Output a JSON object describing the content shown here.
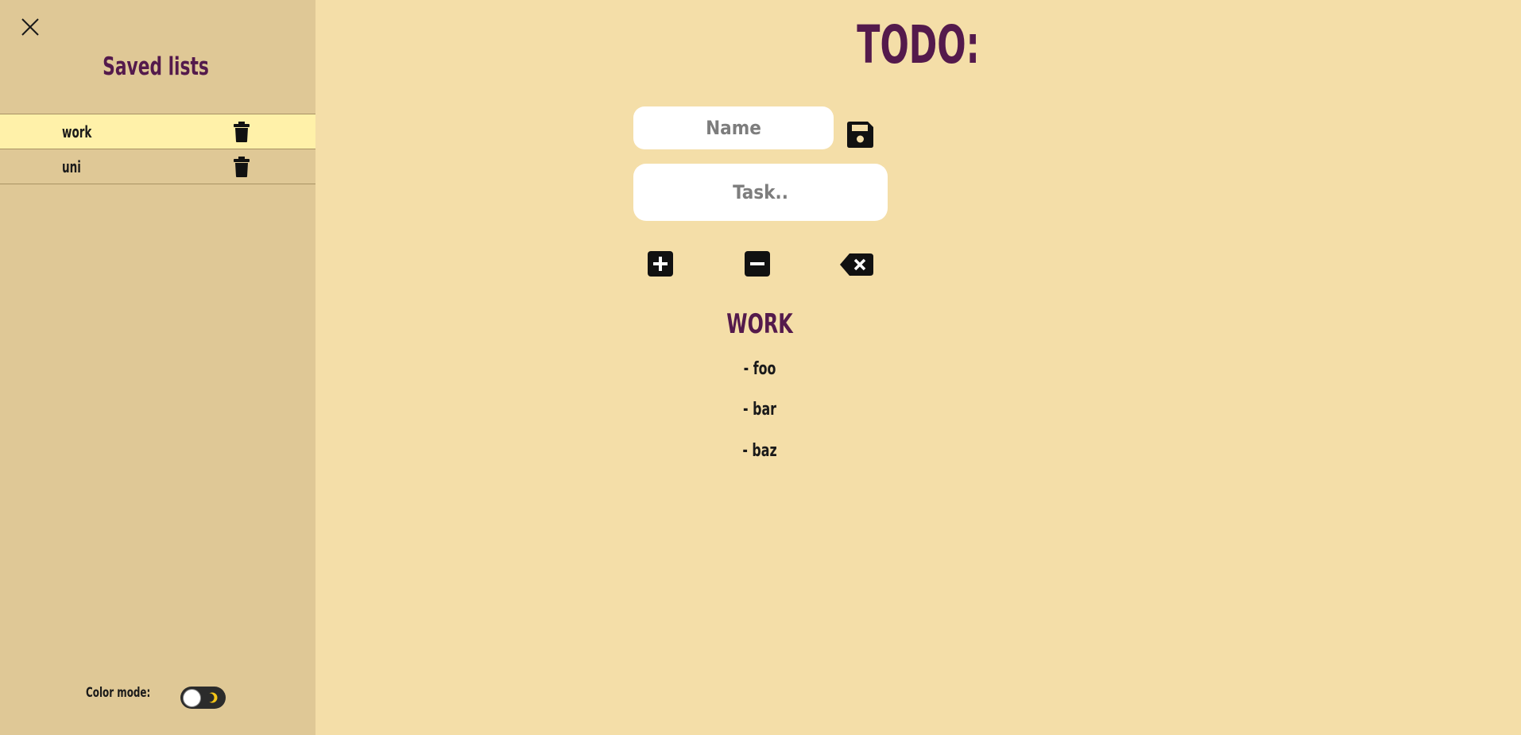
{
  "sidebar": {
    "title": "Saved lists",
    "items": [
      {
        "label": "work",
        "active": true
      },
      {
        "label": "uni",
        "active": false
      }
    ],
    "color_mode_label": "Color mode:"
  },
  "main": {
    "title": "TODO:",
    "name_placeholder": "Name",
    "task_placeholder": "Task..",
    "list_heading": "WORK",
    "tasks": [
      "- foo",
      "- bar",
      "- baz"
    ]
  },
  "icons": {
    "close": "close-icon",
    "trash": "trash-icon",
    "save": "save-icon",
    "add": "plus-square-icon",
    "remove": "minus-square-icon",
    "clear": "backspace-icon",
    "toggle": "moon-icon"
  },
  "colors": {
    "background": "#f4dea8",
    "sidebar": "#dfc896",
    "accent": "#541a4c",
    "active_item": "#fff1a9"
  }
}
